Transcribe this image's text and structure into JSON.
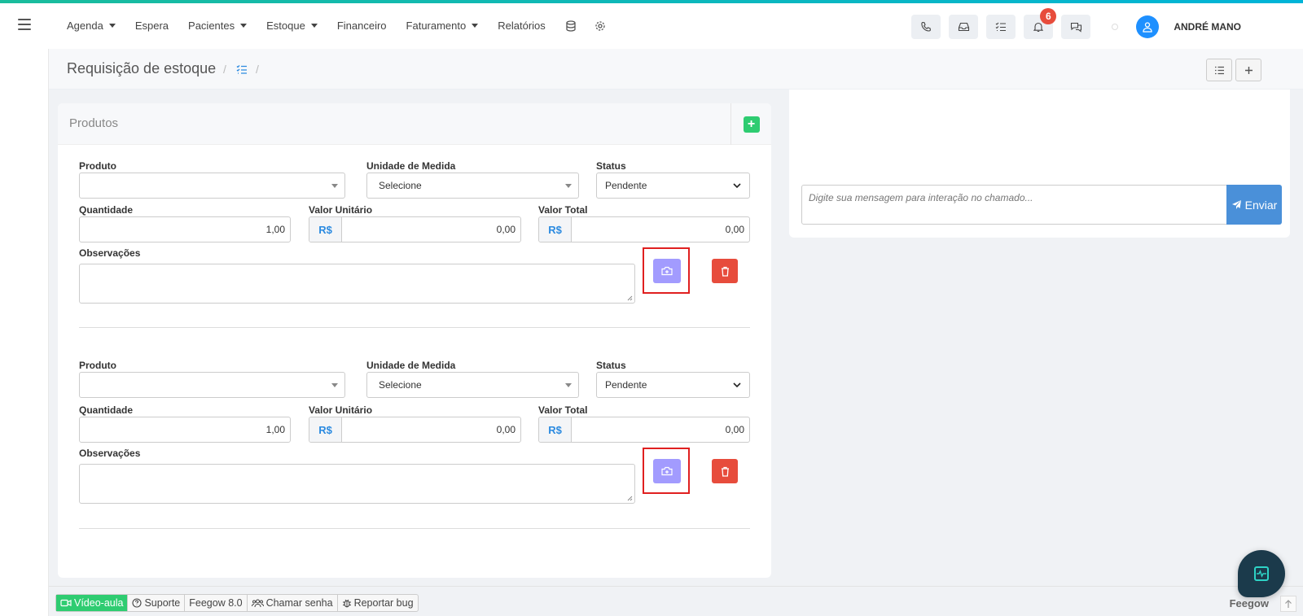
{
  "topnav": {
    "menu": [
      {
        "label": "Agenda",
        "dropdown": true
      },
      {
        "label": "Espera",
        "dropdown": false
      },
      {
        "label": "Pacientes",
        "dropdown": true
      },
      {
        "label": "Estoque",
        "dropdown": true
      },
      {
        "label": "Financeiro",
        "dropdown": false
      },
      {
        "label": "Faturamento",
        "dropdown": true
      },
      {
        "label": "Relatórios",
        "dropdown": false
      }
    ],
    "notification_count": "6",
    "user_name": "ANDRÉ MANO"
  },
  "header": {
    "title": "Requisição de estoque",
    "separator": "/"
  },
  "produtos": {
    "title": "Produtos",
    "add_label": "+",
    "items": [
      {
        "produto_label": "Produto",
        "produto_value": "",
        "unidade_label": "Unidade de Medida",
        "unidade_value": "Selecione",
        "status_label": "Status",
        "status_value": "Pendente",
        "quantidade_label": "Quantidade",
        "quantidade_value": "1,00",
        "valor_unitario_label": "Valor Unitário",
        "valor_unitario_currency": "R$",
        "valor_unitario_value": "0,00",
        "valor_total_label": "Valor Total",
        "valor_total_currency": "R$",
        "valor_total_value": "0,00",
        "observacoes_label": "Observações",
        "observacoes_value": ""
      },
      {
        "produto_label": "Produto",
        "produto_value": "",
        "unidade_label": "Unidade de Medida",
        "unidade_value": "Selecione",
        "status_label": "Status",
        "status_value": "Pendente",
        "quantidade_label": "Quantidade",
        "quantidade_value": "1,00",
        "valor_unitario_label": "Valor Unitário",
        "valor_unitario_currency": "R$",
        "valor_unitario_value": "0,00",
        "valor_total_label": "Valor Total",
        "valor_total_currency": "R$",
        "valor_total_value": "0,00",
        "observacoes_label": "Observações",
        "observacoes_value": ""
      }
    ]
  },
  "chat": {
    "placeholder": "Digite sua mensagem para interação no chamado...",
    "send_label": "Enviar"
  },
  "footer": {
    "video_aula": "Vídeo-aula",
    "suporte": "Suporte",
    "version": "Feegow 8.0",
    "chamar_senha": "Chamar senha",
    "reportar_bug": "Reportar bug",
    "brand": "Feegow"
  },
  "colors": {
    "accent": "#2b8ae0",
    "camera_button": "#a29bfe",
    "delete_button": "#e74c3c",
    "add_button": "#2ecc71",
    "highlight_box": "#e02020"
  }
}
